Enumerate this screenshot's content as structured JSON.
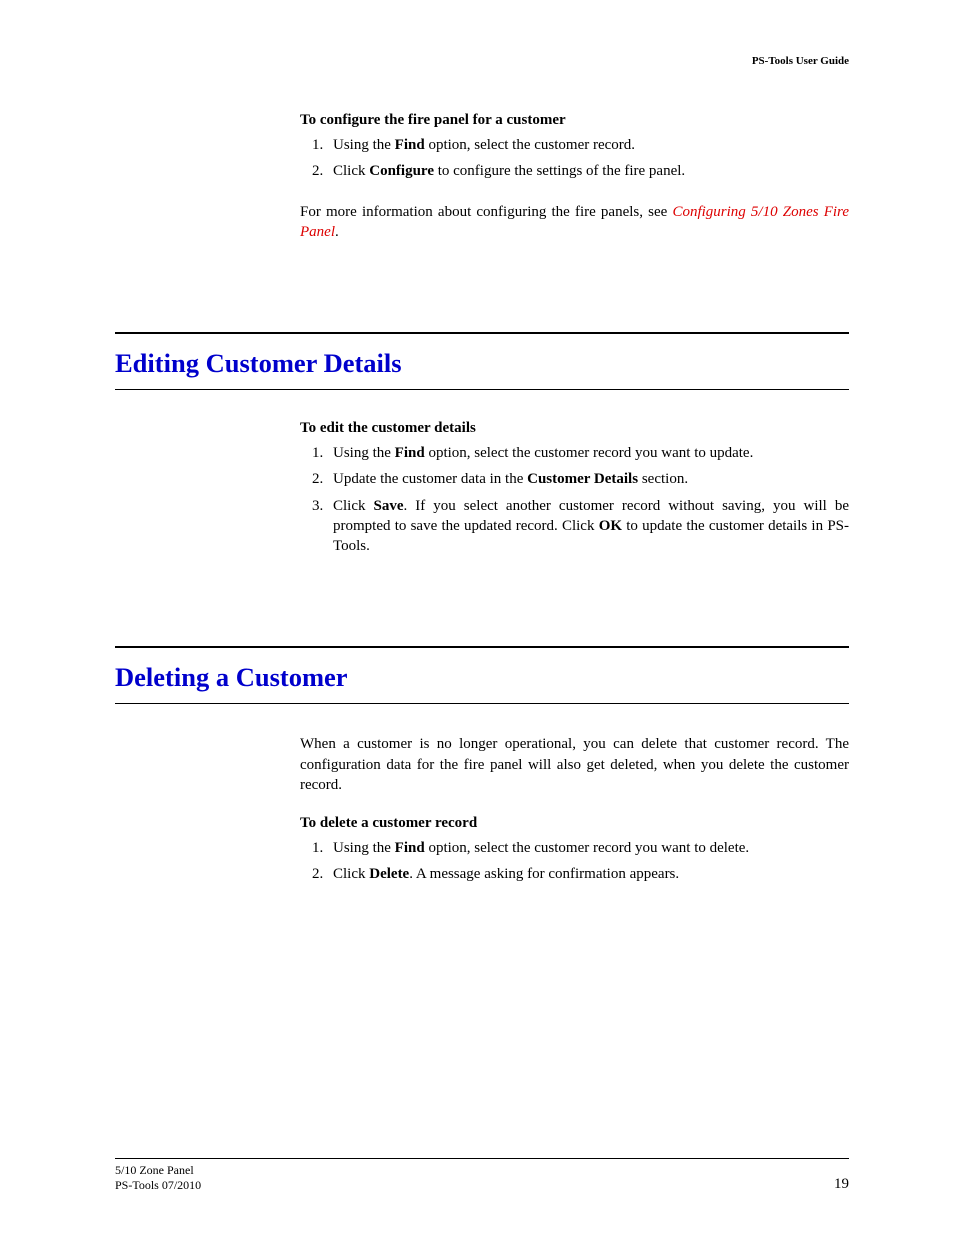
{
  "header": {
    "guide": "PS-Tools User Guide"
  },
  "section1": {
    "subhead": "To configure the fire panel for a customer",
    "step1": {
      "pre": "Using the ",
      "b": "Find",
      "post": " option, select the customer record."
    },
    "step2": {
      "pre": "Click ",
      "b": "Configure",
      "post": " to configure the settings of the fire panel."
    },
    "more": {
      "pre": "For more information about configuring the fire panels, see ",
      "link": "Configuring 5/10 Zones Fire Panel",
      "post": "."
    }
  },
  "section2": {
    "title": "Editing Customer Details",
    "subhead": "To edit the customer details",
    "step1": {
      "pre": "Using the ",
      "b": "Find",
      "post": " option, select the customer record you want to update."
    },
    "step2": {
      "pre": "Update the customer data in the ",
      "b": "Customer Details",
      "post": " section."
    },
    "step3": {
      "pre": "Click ",
      "b1": "Save",
      "mid": ". If you select another customer record without saving, you will be prompted to save the updated record. Click ",
      "b2": "OK",
      "post": " to update the customer details in PS-Tools."
    }
  },
  "section3": {
    "title": "Deleting a Customer",
    "intro": "When a customer is no longer operational, you can delete that customer record. The configuration data for the fire panel will also get deleted, when you delete the customer record.",
    "subhead": "To delete a customer record",
    "step1": {
      "pre": "Using the ",
      "b": "Find",
      "post": " option, select the customer record you want to delete."
    },
    "step2": {
      "pre": "Click ",
      "b": "Delete",
      "post": ". A message asking for confirmation appears."
    }
  },
  "footer": {
    "line1": "5/10 Zone Panel",
    "line2": "PS-Tools 07/2010",
    "page": "19"
  }
}
